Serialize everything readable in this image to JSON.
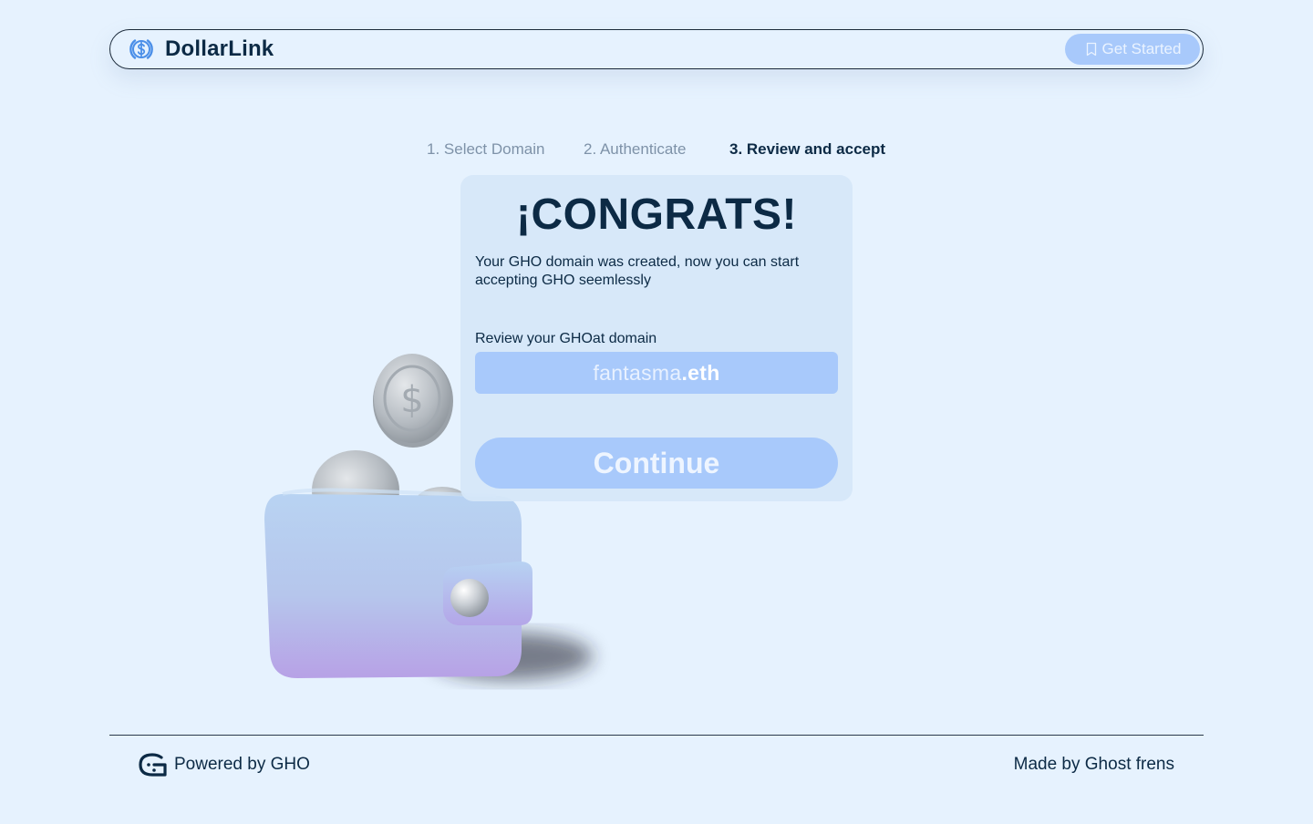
{
  "header": {
    "brand_name": "DollarLink",
    "cta_label": "Get Started",
    "logo_icon": "dollar-circle-icon",
    "cta_icon": "bookmark-icon"
  },
  "stepper": {
    "steps": [
      {
        "label": "1. Select Domain",
        "state": "done"
      },
      {
        "label": "2. Authenticate",
        "state": "done"
      },
      {
        "label": "3. Review and accept",
        "state": "active"
      }
    ]
  },
  "card": {
    "heading": "¡CONGRATS!",
    "subtitle": "Your GHO domain was created, now you can start accepting GHO seemlessly",
    "review_label": "Review your GHOat domain",
    "domain_name": "fantasma",
    "domain_tld": ".eth",
    "continue_label": "Continue"
  },
  "footer": {
    "powered_by": "Powered by GHO",
    "made_by": "Made by Ghost frens",
    "powered_icon": "gho-logo-icon"
  },
  "colors": {
    "background": "#e6f2fe",
    "primary_text": "#0c2a45",
    "accent": "#a8c9fb",
    "muted_step": "#7e92a8"
  }
}
